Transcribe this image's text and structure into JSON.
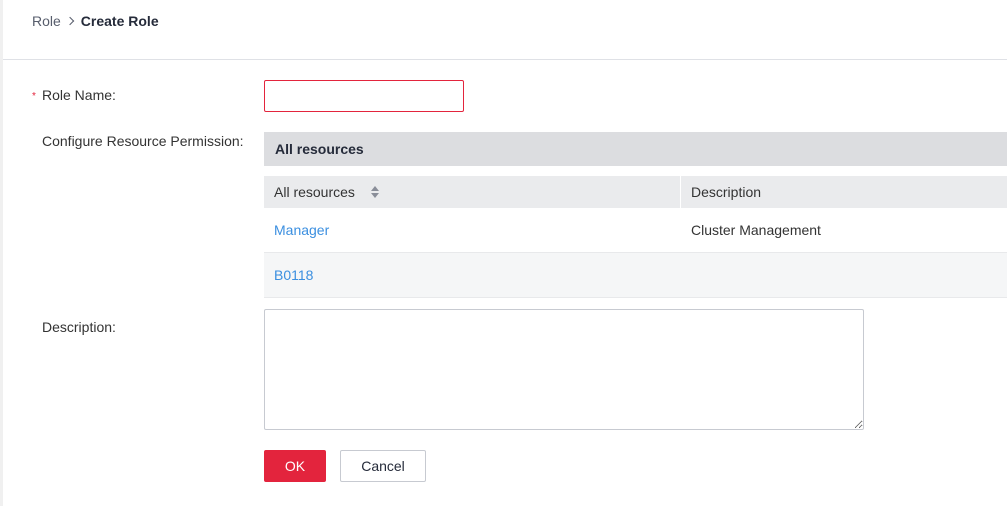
{
  "breadcrumb": {
    "parent": "Role",
    "current": "Create Role"
  },
  "form": {
    "role_name": {
      "label": "Role Name:",
      "required_marker": "*",
      "value": ""
    },
    "permission": {
      "label": "Configure Resource Permission:",
      "panel_title": "All resources",
      "columns": [
        "All resources",
        "Description"
      ],
      "rows": [
        {
          "name": "Manager",
          "description": "Cluster Management"
        },
        {
          "name": "B0118",
          "description": ""
        }
      ]
    },
    "description": {
      "label": "Description:",
      "value": ""
    }
  },
  "buttons": {
    "ok": "OK",
    "cancel": "Cancel"
  },
  "colors": {
    "accent_red": "#e3243d",
    "link_blue": "#3b8fe0"
  }
}
